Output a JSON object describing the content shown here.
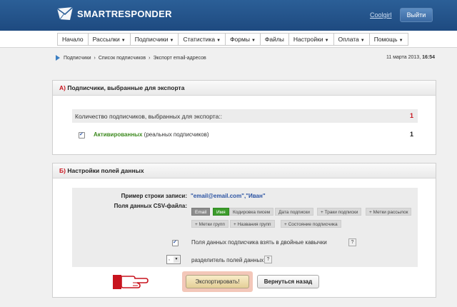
{
  "header": {
    "brand": "SMARTRESPONDER",
    "username": "Coolgirl",
    "logout_label": "Выйти",
    "brand_color": "#1e4a80"
  },
  "nav": {
    "items": [
      {
        "label": "Начало",
        "dropdown": false
      },
      {
        "label": "Рассылки",
        "dropdown": true
      },
      {
        "label": "Подписчики",
        "dropdown": true
      },
      {
        "label": "Статистика",
        "dropdown": true
      },
      {
        "label": "Формы",
        "dropdown": true
      },
      {
        "label": "Файлы",
        "dropdown": false
      },
      {
        "label": "Настройки",
        "dropdown": true
      },
      {
        "label": "Оплата",
        "dropdown": true
      },
      {
        "label": "Помощь",
        "dropdown": true
      }
    ]
  },
  "breadcrumb": {
    "items": [
      "Подписчики",
      "Список подписчиков",
      "Экспорт email-адресов"
    ],
    "separator": "›"
  },
  "datetime": {
    "date": "11 марта 2013,",
    "time": "16:54"
  },
  "section_a": {
    "letter": "А)",
    "title": "Подписчики, выбранные для экспорта",
    "count_label": "Количество подписчиков, выбранных для экспорта::",
    "count_total": "1",
    "active_label": "Активированных",
    "active_note": "(реальных подписчиков)",
    "active_count": "1",
    "active_checked": true
  },
  "section_b": {
    "letter": "Б)",
    "title": "Настройки полей данных",
    "example_label": "Пример строки записи:",
    "example_value": "\"email@email.com\",\"Иван\"",
    "fields_label": "Поля данных CSV-файла:",
    "tags": [
      {
        "label": "Email",
        "kind": "email"
      },
      {
        "label": "Имя",
        "kind": "name"
      },
      {
        "label": "Кодировка писем",
        "kind": "plain"
      },
      {
        "label": "Дата подписки",
        "kind": "plain"
      },
      {
        "label": "+ Траки подписки",
        "kind": "plain"
      },
      {
        "label": "+ Метки рассылок",
        "kind": "plain"
      },
      {
        "label": "+ Метки групп",
        "kind": "plain"
      },
      {
        "label": "+ Названия групп",
        "kind": "plain"
      },
      {
        "label": "+ Состояние подписчика",
        "kind": "plain"
      }
    ],
    "quotes_label": "Поля данных подписчика взять в двойные кавычки",
    "quotes_checked": true,
    "separator_value": ",",
    "separator_label": "разделитель полей данных",
    "help_glyph": "?"
  },
  "actions": {
    "export_label": "Экспортировать!",
    "back_label": "Вернуться назад",
    "pointer_icon": "pointing-hand-icon"
  }
}
